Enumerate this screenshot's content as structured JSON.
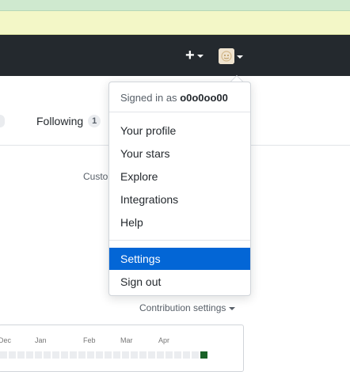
{
  "header": {
    "plus_symbol": "+"
  },
  "nav": {
    "following_label": "Following",
    "following_count": "1"
  },
  "profile": {
    "custom_text": "Custo",
    "contribution_settings": "Contribution settings"
  },
  "calendar": {
    "months": [
      "Dec",
      "Jan",
      "Feb",
      "Mar",
      "Apr"
    ]
  },
  "dropdown": {
    "signed_in_prefix": "Signed in as",
    "username": "o0o0oo00",
    "items": [
      {
        "label": "Your profile"
      },
      {
        "label": "Your stars"
      },
      {
        "label": "Explore"
      },
      {
        "label": "Integrations"
      },
      {
        "label": "Help"
      },
      {
        "label": "Settings",
        "selected": true
      },
      {
        "label": "Sign out"
      }
    ]
  },
  "colors": {
    "header_bg": "#24292e",
    "selected_bg": "#0366d6",
    "contribution_active": "#196127"
  },
  "icons": [
    "plus-icon",
    "caret-down-icon",
    "avatar-icon"
  ]
}
